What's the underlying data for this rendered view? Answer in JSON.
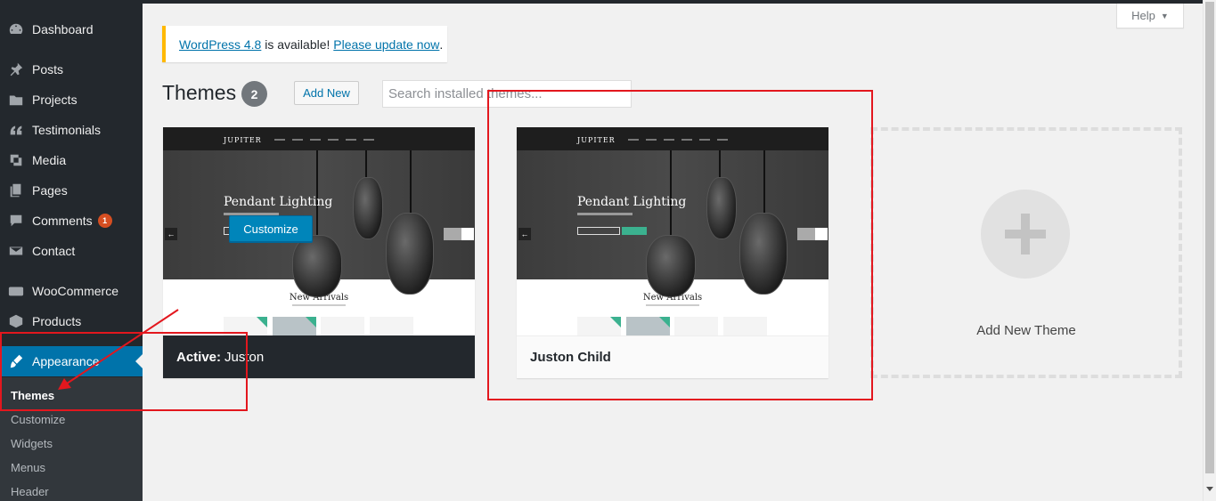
{
  "sidebar": {
    "items": [
      {
        "label": "Dashboard",
        "icon": "dashboard-icon"
      },
      {
        "label": "Posts",
        "icon": "pin-icon"
      },
      {
        "label": "Projects",
        "icon": "folder-icon"
      },
      {
        "label": "Testimonials",
        "icon": "quote-icon"
      },
      {
        "label": "Media",
        "icon": "media-icon"
      },
      {
        "label": "Pages",
        "icon": "pages-icon"
      },
      {
        "label": "Comments",
        "icon": "comment-icon",
        "badge": "1"
      },
      {
        "label": "Contact",
        "icon": "mail-icon"
      },
      {
        "label": "WooCommerce",
        "icon": "woo-icon"
      },
      {
        "label": "Products",
        "icon": "box-icon"
      },
      {
        "label": "Appearance",
        "icon": "brush-icon",
        "active": true
      }
    ],
    "submenu": [
      {
        "label": "Themes",
        "current": true
      },
      {
        "label": "Customize"
      },
      {
        "label": "Widgets"
      },
      {
        "label": "Menus"
      },
      {
        "label": "Header"
      }
    ]
  },
  "help": {
    "label": "Help",
    "arrow": "▼"
  },
  "notice": {
    "link1": "WordPress 4.8",
    "text": " is available! ",
    "link2": "Please update now",
    "end": "."
  },
  "header": {
    "title": "Themes",
    "count": "2",
    "add_new": "Add New",
    "search_placeholder": "Search installed themes..."
  },
  "themes": [
    {
      "active_label": "Active:",
      "name": "Juston",
      "action": "Customize",
      "screenshot": {
        "logo": "JUPITER",
        "hero_title": "Pendant Lighting",
        "section_title": "New Arrivals"
      }
    },
    {
      "name": "Juston Child",
      "screenshot": {
        "logo": "JUPITER",
        "hero_title": "Pendant Lighting",
        "section_title": "New Arrivals"
      }
    }
  ],
  "add_theme": {
    "label": "Add New Theme"
  },
  "colors": {
    "sidebar": "#23282d",
    "accent": "#0073aa",
    "notice_border": "#ffb900",
    "badge": "#d54e21",
    "annotation": "#e3171e"
  }
}
